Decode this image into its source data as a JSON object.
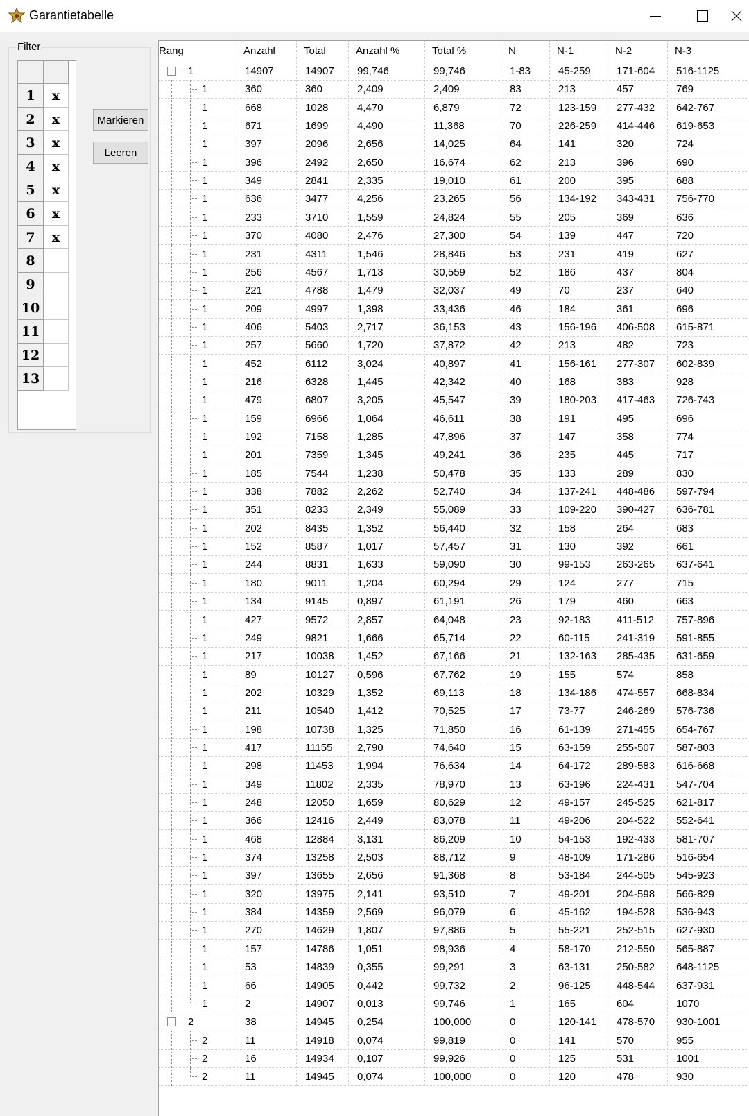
{
  "window": {
    "title": "Garantietabelle"
  },
  "filter": {
    "label": "Filter",
    "buttons": {
      "mark": "Markieren",
      "clear": "Leeren"
    },
    "rows": [
      {
        "num": "1",
        "mark": "x"
      },
      {
        "num": "2",
        "mark": "x"
      },
      {
        "num": "3",
        "mark": "x"
      },
      {
        "num": "4",
        "mark": "x"
      },
      {
        "num": "5",
        "mark": "x"
      },
      {
        "num": "6",
        "mark": "x"
      },
      {
        "num": "7",
        "mark": "x"
      },
      {
        "num": "8",
        "mark": ""
      },
      {
        "num": "9",
        "mark": ""
      },
      {
        "num": "10",
        "mark": ""
      },
      {
        "num": "11",
        "mark": ""
      },
      {
        "num": "12",
        "mark": ""
      },
      {
        "num": "13",
        "mark": ""
      }
    ]
  },
  "table": {
    "columns": [
      "Rang",
      "Anzahl",
      "Total",
      "Anzahl %",
      "Total %",
      "N",
      "N-1",
      "N-2",
      "N-3"
    ],
    "groups": [
      {
        "row": [
          "1",
          "14907",
          "14907",
          "99,746",
          "99,746",
          "1-83",
          "45-259",
          "171-604",
          "516-1125"
        ],
        "children": [
          [
            "1",
            "360",
            "360",
            "2,409",
            "2,409",
            "83",
            "213",
            "457",
            "769"
          ],
          [
            "1",
            "668",
            "1028",
            "4,470",
            "6,879",
            "72",
            "123-159",
            "277-432",
            "642-767"
          ],
          [
            "1",
            "671",
            "1699",
            "4,490",
            "11,368",
            "70",
            "226-259",
            "414-446",
            "619-653"
          ],
          [
            "1",
            "397",
            "2096",
            "2,656",
            "14,025",
            "64",
            "141",
            "320",
            "724"
          ],
          [
            "1",
            "396",
            "2492",
            "2,650",
            "16,674",
            "62",
            "213",
            "396",
            "690"
          ],
          [
            "1",
            "349",
            "2841",
            "2,335",
            "19,010",
            "61",
            "200",
            "395",
            "688"
          ],
          [
            "1",
            "636",
            "3477",
            "4,256",
            "23,265",
            "56",
            "134-192",
            "343-431",
            "756-770"
          ],
          [
            "1",
            "233",
            "3710",
            "1,559",
            "24,824",
            "55",
            "205",
            "369",
            "636"
          ],
          [
            "1",
            "370",
            "4080",
            "2,476",
            "27,300",
            "54",
            "139",
            "447",
            "720"
          ],
          [
            "1",
            "231",
            "4311",
            "1,546",
            "28,846",
            "53",
            "231",
            "419",
            "627"
          ],
          [
            "1",
            "256",
            "4567",
            "1,713",
            "30,559",
            "52",
            "186",
            "437",
            "804"
          ],
          [
            "1",
            "221",
            "4788",
            "1,479",
            "32,037",
            "49",
            "70",
            "237",
            "640"
          ],
          [
            "1",
            "209",
            "4997",
            "1,398",
            "33,436",
            "46",
            "184",
            "361",
            "696"
          ],
          [
            "1",
            "406",
            "5403",
            "2,717",
            "36,153",
            "43",
            "156-196",
            "406-508",
            "615-871"
          ],
          [
            "1",
            "257",
            "5660",
            "1,720",
            "37,872",
            "42",
            "213",
            "482",
            "723"
          ],
          [
            "1",
            "452",
            "6112",
            "3,024",
            "40,897",
            "41",
            "156-161",
            "277-307",
            "602-839"
          ],
          [
            "1",
            "216",
            "6328",
            "1,445",
            "42,342",
            "40",
            "168",
            "383",
            "928"
          ],
          [
            "1",
            "479",
            "6807",
            "3,205",
            "45,547",
            "39",
            "180-203",
            "417-463",
            "726-743"
          ],
          [
            "1",
            "159",
            "6966",
            "1,064",
            "46,611",
            "38",
            "191",
            "495",
            "696"
          ],
          [
            "1",
            "192",
            "7158",
            "1,285",
            "47,896",
            "37",
            "147",
            "358",
            "774"
          ],
          [
            "1",
            "201",
            "7359",
            "1,345",
            "49,241",
            "36",
            "235",
            "445",
            "717"
          ],
          [
            "1",
            "185",
            "7544",
            "1,238",
            "50,478",
            "35",
            "133",
            "289",
            "830"
          ],
          [
            "1",
            "338",
            "7882",
            "2,262",
            "52,740",
            "34",
            "137-241",
            "448-486",
            "597-794"
          ],
          [
            "1",
            "351",
            "8233",
            "2,349",
            "55,089",
            "33",
            "109-220",
            "390-427",
            "636-781"
          ],
          [
            "1",
            "202",
            "8435",
            "1,352",
            "56,440",
            "32",
            "158",
            "264",
            "683"
          ],
          [
            "1",
            "152",
            "8587",
            "1,017",
            "57,457",
            "31",
            "130",
            "392",
            "661"
          ],
          [
            "1",
            "244",
            "8831",
            "1,633",
            "59,090",
            "30",
            "99-153",
            "263-265",
            "637-641"
          ],
          [
            "1",
            "180",
            "9011",
            "1,204",
            "60,294",
            "29",
            "124",
            "277",
            "715"
          ],
          [
            "1",
            "134",
            "9145",
            "0,897",
            "61,191",
            "26",
            "179",
            "460",
            "663"
          ],
          [
            "1",
            "427",
            "9572",
            "2,857",
            "64,048",
            "23",
            "92-183",
            "411-512",
            "757-896"
          ],
          [
            "1",
            "249",
            "9821",
            "1,666",
            "65,714",
            "22",
            "60-115",
            "241-319",
            "591-855"
          ],
          [
            "1",
            "217",
            "10038",
            "1,452",
            "67,166",
            "21",
            "132-163",
            "285-435",
            "631-659"
          ],
          [
            "1",
            "89",
            "10127",
            "0,596",
            "67,762",
            "19",
            "155",
            "574",
            "858"
          ],
          [
            "1",
            "202",
            "10329",
            "1,352",
            "69,113",
            "18",
            "134-186",
            "474-557",
            "668-834"
          ],
          [
            "1",
            "211",
            "10540",
            "1,412",
            "70,525",
            "17",
            "73-77",
            "246-269",
            "576-736"
          ],
          [
            "1",
            "198",
            "10738",
            "1,325",
            "71,850",
            "16",
            "61-139",
            "271-455",
            "654-767"
          ],
          [
            "1",
            "417",
            "11155",
            "2,790",
            "74,640",
            "15",
            "63-159",
            "255-507",
            "587-803"
          ],
          [
            "1",
            "298",
            "11453",
            "1,994",
            "76,634",
            "14",
            "64-172",
            "289-583",
            "616-668"
          ],
          [
            "1",
            "349",
            "11802",
            "2,335",
            "78,970",
            "13",
            "63-196",
            "224-431",
            "547-704"
          ],
          [
            "1",
            "248",
            "12050",
            "1,659",
            "80,629",
            "12",
            "49-157",
            "245-525",
            "621-817"
          ],
          [
            "1",
            "366",
            "12416",
            "2,449",
            "83,078",
            "11",
            "49-206",
            "204-522",
            "552-641"
          ],
          [
            "1",
            "468",
            "12884",
            "3,131",
            "86,209",
            "10",
            "54-153",
            "192-433",
            "581-707"
          ],
          [
            "1",
            "374",
            "13258",
            "2,503",
            "88,712",
            "9",
            "48-109",
            "171-286",
            "516-654"
          ],
          [
            "1",
            "397",
            "13655",
            "2,656",
            "91,368",
            "8",
            "53-184",
            "244-505",
            "545-923"
          ],
          [
            "1",
            "320",
            "13975",
            "2,141",
            "93,510",
            "7",
            "49-201",
            "204-598",
            "566-829"
          ],
          [
            "1",
            "384",
            "14359",
            "2,569",
            "96,079",
            "6",
            "45-162",
            "194-528",
            "536-943"
          ],
          [
            "1",
            "270",
            "14629",
            "1,807",
            "97,886",
            "5",
            "55-221",
            "252-515",
            "627-930"
          ],
          [
            "1",
            "157",
            "14786",
            "1,051",
            "98,936",
            "4",
            "58-170",
            "212-550",
            "565-887"
          ],
          [
            "1",
            "53",
            "14839",
            "0,355",
            "99,291",
            "3",
            "63-131",
            "250-582",
            "648-1125"
          ],
          [
            "1",
            "66",
            "14905",
            "0,442",
            "99,732",
            "2",
            "96-125",
            "448-544",
            "637-931"
          ],
          [
            "1",
            "2",
            "14907",
            "0,013",
            "99,746",
            "1",
            "165",
            "604",
            "1070"
          ]
        ]
      },
      {
        "row": [
          "2",
          "38",
          "14945",
          "0,254",
          "100,000",
          "0",
          "120-141",
          "478-570",
          "930-1001"
        ],
        "children": [
          [
            "2",
            "11",
            "14918",
            "0,074",
            "99,819",
            "0",
            "141",
            "570",
            "955"
          ],
          [
            "2",
            "16",
            "14934",
            "0,107",
            "99,926",
            "0",
            "125",
            "531",
            "1001"
          ],
          [
            "2",
            "11",
            "14945",
            "0,074",
            "100,000",
            "0",
            "120",
            "478",
            "930"
          ]
        ]
      }
    ]
  }
}
